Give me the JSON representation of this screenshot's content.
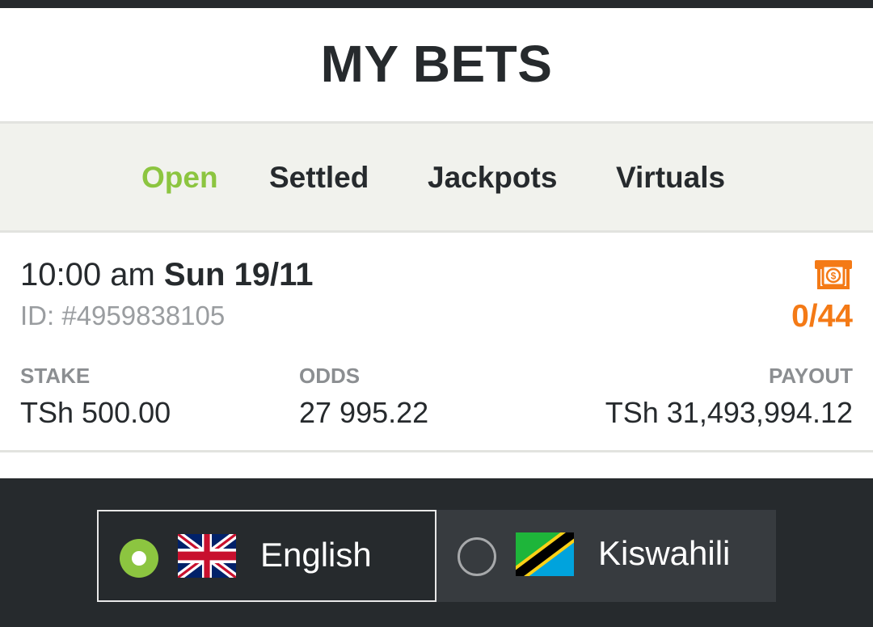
{
  "header": {
    "title": "MY BETS"
  },
  "tabs": [
    {
      "label": "Open",
      "active": true
    },
    {
      "label": "Settled",
      "active": false
    },
    {
      "label": "Jackpots",
      "active": false
    },
    {
      "label": "Virtuals",
      "active": false
    }
  ],
  "bet": {
    "time": "10:00 am",
    "date": "Sun 19/11",
    "id": "ID: #4959838105",
    "cashout_icon": "cashout-icon",
    "progress": "0/44",
    "stake_label": "STAKE",
    "stake_value": "TSh 500.00",
    "odds_label": "ODDS",
    "odds_value": "27 995.22",
    "payout_label": "PAYOUT",
    "payout_value": "TSh 31,493,994.12"
  },
  "languages": [
    {
      "label": "English",
      "selected": true,
      "flag": "uk-flag-icon"
    },
    {
      "label": "Kiswahili",
      "selected": false,
      "flag": "tanzania-flag-icon"
    }
  ],
  "colors": {
    "accent": "#8cc540",
    "orange": "#f47a16",
    "dark": "#262a2d"
  }
}
